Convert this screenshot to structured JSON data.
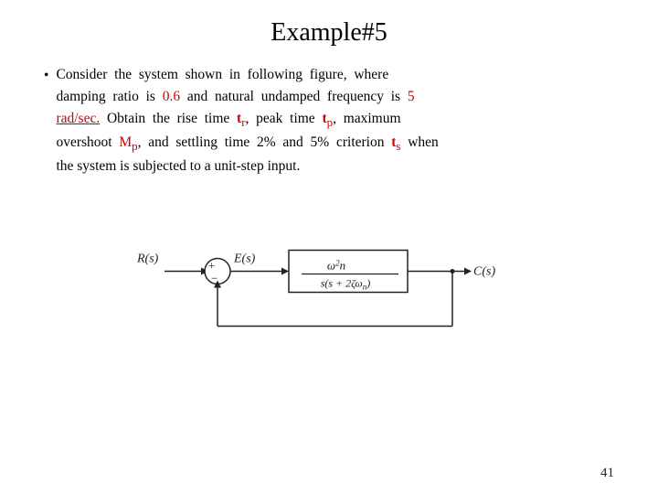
{
  "title": "Example#5",
  "bullet": "•",
  "paragraph": {
    "line1_pre": "Consider  the  system  shown  in  following  figure,  where",
    "line2_pre": "damping  ratio  is ",
    "damping_value": "0.6",
    "line2_mid": " and  natural  undamped  frequency  is ",
    "freq_value": "5",
    "line3_pre": "rad/sec.",
    "line3_mid": "  Obtain  the  rise  time  ",
    "tr": "t",
    "tr_sub": "r",
    "line3_mid2": ",  peak  time  ",
    "tp": "t",
    "tp_sub": "p",
    "line3_mid3": ",  maximum",
    "line4_pre": "overshoot  ",
    "mp": "M",
    "mp_sub": "p",
    "line4_mid": ",  and  settling  time  2%  and  5%  criterion  ",
    "ts": "t",
    "ts_sub": "s",
    "line4_end": " when",
    "line5": "the  system  is  subjected  to  a  unit-step  input."
  },
  "page_number": "41"
}
